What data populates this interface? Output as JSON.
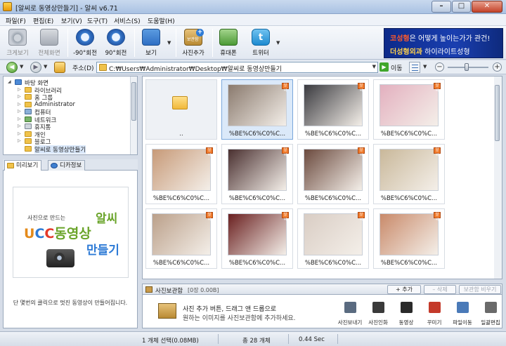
{
  "window": {
    "title": "[알씨로 동영상만들기] - 알씨 v6.71",
    "min_glyph": "–",
    "max_glyph": "□",
    "close_glyph": "✕"
  },
  "menu": [
    "파일(F)",
    "편집(E)",
    "보기(V)",
    "도구(T)",
    "서비스(S)",
    "도움말(H)"
  ],
  "toolbar": {
    "zoom_view": "크게보기",
    "fullscreen": "전체화면",
    "rotate_left": "-90°회전",
    "rotate_right": "90°회전",
    "view": "보기",
    "add_photo": "사진추가",
    "box_label": "보관함",
    "mobile": "휴대폰",
    "twitter": "트위터",
    "twitter_glyph": "t"
  },
  "ad": {
    "line1_prefix": "코성형",
    "line1_rest": "은 어떻게 높이는가가 관건!",
    "line2_prefix": "더성형외과",
    "line2_rest": " 하이라이트성형"
  },
  "address": {
    "label": "주소(D)",
    "path": "C:₩Users₩Administrator₩Desktop₩알씨로 동영상만들기",
    "go_label": "이동",
    "back_glyph": "◀",
    "forward_glyph": "▶",
    "go_glyph": "▶",
    "zoom_minus": "−",
    "zoom_plus": "+"
  },
  "tree": [
    {
      "label": "바탕 화면",
      "icon": "desktop-icon",
      "level": 0,
      "expander": "◢"
    },
    {
      "label": "라이브러리",
      "icon": "library-folder-icon",
      "level": 1,
      "expander": "▷"
    },
    {
      "label": "홈 그룹",
      "icon": "homegroup-icon",
      "level": 1,
      "expander": "▷"
    },
    {
      "label": "Administrator",
      "icon": "user-folder-icon",
      "level": 1,
      "expander": "▷"
    },
    {
      "label": "컴퓨터",
      "icon": "computer-icon",
      "level": 1,
      "expander": "▷"
    },
    {
      "label": "네트워크",
      "icon": "network-icon",
      "level": 1,
      "expander": "▷"
    },
    {
      "label": "휴지통",
      "icon": "recycle-bin-icon",
      "level": 1,
      "expander": "▷"
    },
    {
      "label": "개인",
      "icon": "folder-icon",
      "level": 1,
      "expander": "▷"
    },
    {
      "label": "블로그",
      "icon": "folder-icon",
      "level": 1,
      "expander": "▷"
    },
    {
      "label": "알씨로 동영상만들기",
      "icon": "folder-icon",
      "level": 1,
      "expander": "",
      "selected": true
    }
  ],
  "tabs": {
    "preview": "미리보기",
    "camera_info": "디카정보"
  },
  "preview": {
    "small_text": "사진으로 만드는",
    "ucc_u": "U",
    "ucc_c1": "C",
    "ucc_c2": "C",
    "big_text": "동영상",
    "right_top": "알씨",
    "right_bottom": "만들기",
    "caption": "단 몇번의 클릭으로 멋진 동영상이 만들어집니다."
  },
  "thumbnails": [
    {
      "name": "..",
      "type": "up"
    },
    {
      "name": "%BE%C6%C0%C...",
      "type": "photo",
      "selected": true,
      "color": "#8a7a6e"
    },
    {
      "name": "%BE%C6%C0%C...",
      "type": "photo",
      "color": "#3a3a3f"
    },
    {
      "name": "%BE%C6%C0%C...",
      "type": "photo",
      "color": "#e3b0bf"
    },
    {
      "name": "%BE%C6%C0%C...",
      "type": "photo",
      "color": "#c79a78"
    },
    {
      "name": "%BE%C6%C0%C...",
      "type": "photo",
      "color": "#4a3030"
    },
    {
      "name": "%BE%C6%C0%C...",
      "type": "photo",
      "color": "#6b4a3e"
    },
    {
      "name": "%BE%C6%C0%C...",
      "type": "photo",
      "color": "#c9b89a"
    },
    {
      "name": "%BE%C6%C0%C...",
      "type": "photo",
      "color": "#bba08a"
    },
    {
      "name": "%BE%C6%C0%C...",
      "type": "photo",
      "color": "#6a2020"
    },
    {
      "name": "%BE%C6%C0%C...",
      "type": "photo",
      "color": "#d9cdc4"
    },
    {
      "name": "%BE%C6%C0%C...",
      "type": "photo",
      "color": "#c98a6a"
    }
  ],
  "badge_text": "알씨",
  "storage": {
    "title": "사진보관함",
    "count": "[0장 0.00B]",
    "add_button": "+ 추가",
    "delete_button": "– 삭제",
    "empty_button": "보관함 비우기",
    "hint_line1": "사진 추가 버튼, 드래그 앤 드롭으로",
    "hint_line2": "원하는 이미지를 사진보관함에 추가하세요.",
    "actions": [
      {
        "label": "사진보내기",
        "icon": "send-photo-icon",
        "color": "#5a6b80"
      },
      {
        "label": "사진인화",
        "icon": "print-photo-icon",
        "color": "#3a3a3a"
      },
      {
        "label": "동영상",
        "icon": "video-icon",
        "color": "#2a2a2a"
      },
      {
        "label": "꾸미기",
        "icon": "decorate-icon",
        "color": "#c43a2a"
      },
      {
        "label": "파일이동",
        "icon": "move-file-icon",
        "color": "#4a7ab8"
      },
      {
        "label": "일괄편집",
        "icon": "batch-edit-icon",
        "color": "#6a6a6a"
      }
    ]
  },
  "status": {
    "selection": "1 개체 선택(0.08MB)",
    "total": "총 28 개체",
    "time": "0.44 Sec"
  },
  "colors": {
    "accent": "#2e7bd6",
    "folder": "#f0c24a",
    "selection": "#dbe9f9"
  }
}
